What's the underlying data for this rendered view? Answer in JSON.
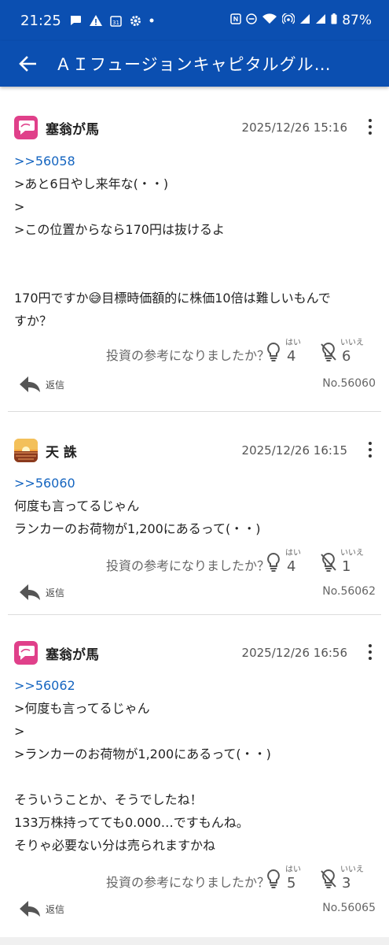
{
  "status_bar": {
    "time": "21:25",
    "battery": "87%",
    "left_icons": [
      "chat-bubble-icon",
      "warning-icon",
      "calendar-icon",
      "settings-icon",
      "dot-icon"
    ],
    "right_icons": [
      "nfc-icon",
      "dnd-icon",
      "wifi-icon",
      "hotspot-icon",
      "signal-icon",
      "signal-icon",
      "battery-icon"
    ]
  },
  "app_bar": {
    "title": "ＡＩフュージョンキャピタルグル…"
  },
  "question_text": "投資の参考になりましたか？",
  "yes_label": "はい",
  "no_label": "いいえ",
  "reply_label": "返信",
  "posts": [
    {
      "username": "塞翁が馬",
      "avatar": "pink-chat-avatar",
      "date": "2025/12/26 15:16",
      "reply_to": ">>56058",
      "lines": [
        ">あと6日やし来年な(・・)",
        ">",
        ">この位置からなら170円は抜けるよ",
        "",
        "",
        "170円ですか😅目標時価額的に株価10倍は難しいもんで",
        "すか？"
      ],
      "yes_count": "4",
      "no_count": "6",
      "post_no": "No.56060"
    },
    {
      "username": "天 誅",
      "avatar": "sunset-avatar",
      "date": "2025/12/26 16:15",
      "reply_to": ">>56060",
      "lines": [
        "何度も言ってるじゃん",
        "ランカーのお荷物が1,200にあるって(・・)"
      ],
      "yes_count": "4",
      "no_count": "1",
      "post_no": "No.56062"
    },
    {
      "username": "塞翁が馬",
      "avatar": "pink-chat-avatar",
      "date": "2025/12/26 16:56",
      "reply_to": ">>56062",
      "lines": [
        ">何度も言ってるじゃん",
        ">",
        ">ランカーのお荷物が1,200にあるって(・・)",
        "",
        "そういうことか、そうでしたね！",
        "133万株持ってても0.000…ですもんね。",
        "そりゃ必要ない分は売られますかね"
      ],
      "yes_count": "5",
      "no_count": "3",
      "post_no": "No.56065"
    }
  ]
}
